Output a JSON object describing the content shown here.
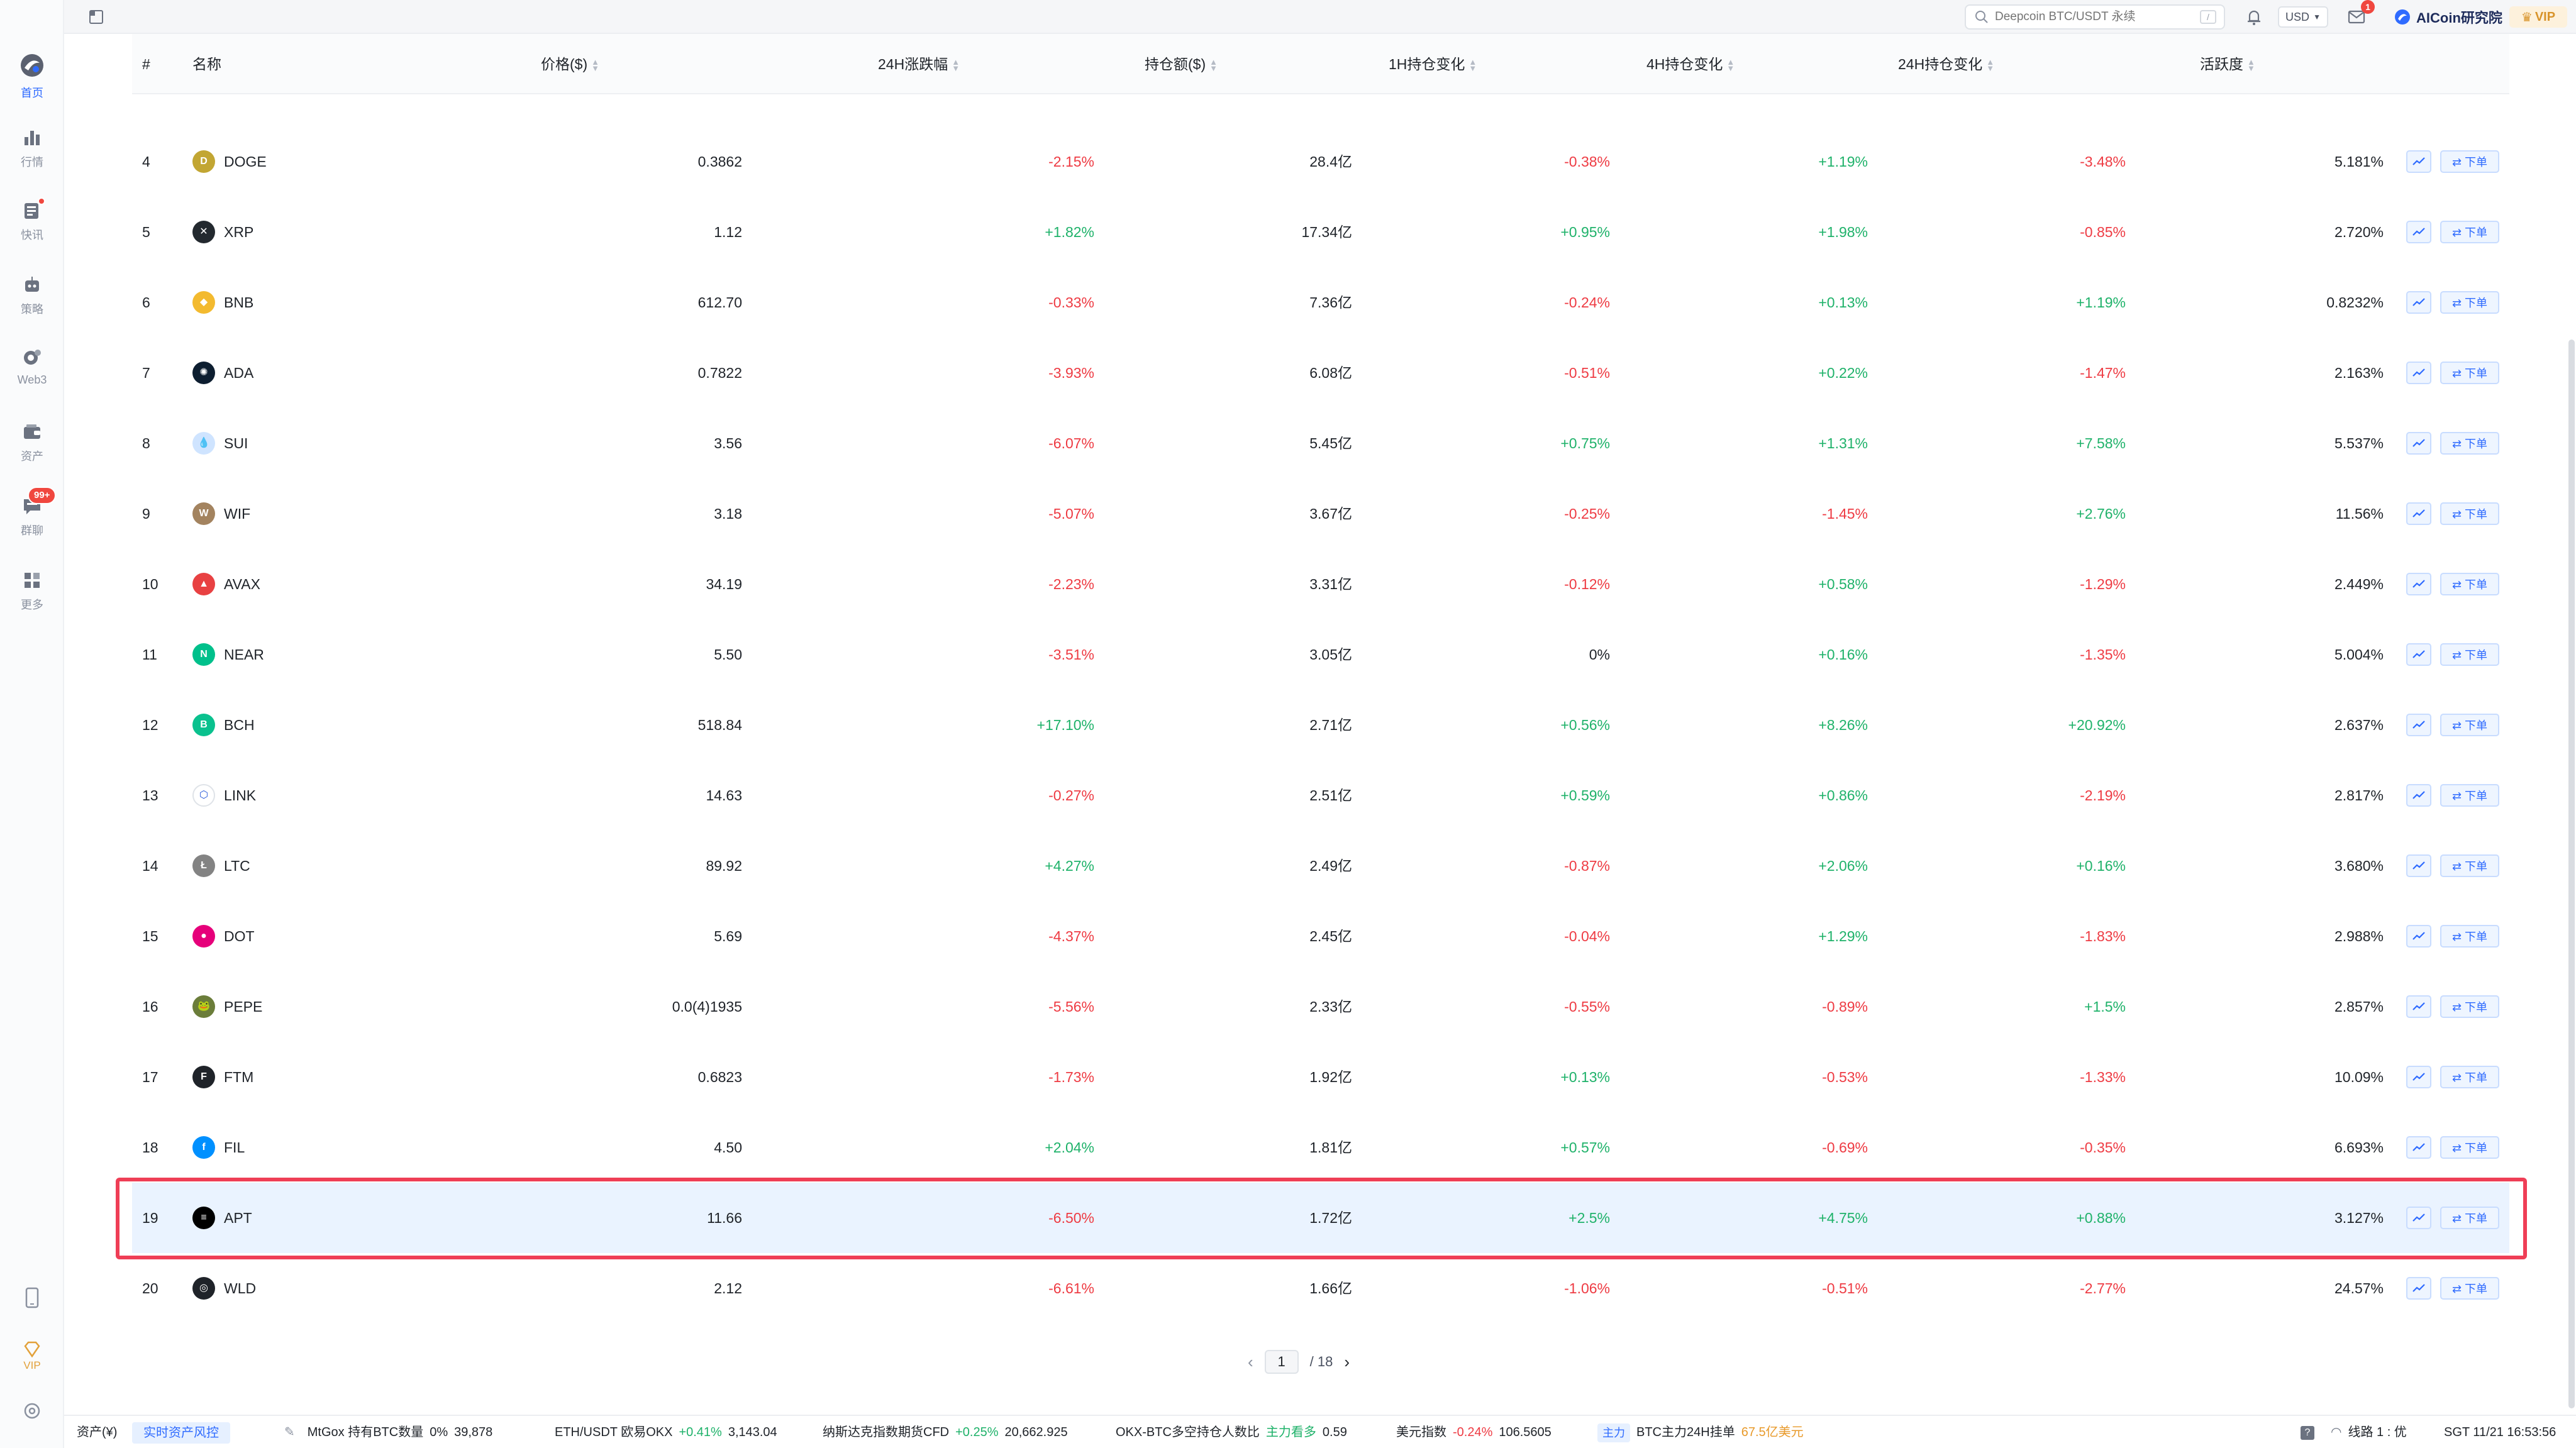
{
  "topbar": {
    "search_placeholder": "Deepcoin BTC/USDT 永续",
    "search_key": "/",
    "currency": "USD",
    "mail_badge": "1",
    "user_name": "AICoin研究院",
    "vip_label": "VIP"
  },
  "sidebar": {
    "items": [
      {
        "label": "首页",
        "icon": "home-icon"
      },
      {
        "label": "行情",
        "icon": "market-chart-icon"
      },
      {
        "label": "快讯",
        "icon": "news-icon"
      },
      {
        "label": "策略",
        "icon": "robot-icon"
      },
      {
        "label": "Web3",
        "icon": "web3-icon"
      },
      {
        "label": "资产",
        "icon": "wallet-icon"
      },
      {
        "label": "群聊",
        "icon": "chat-icon"
      },
      {
        "label": "更多",
        "icon": "grid-more-icon"
      }
    ],
    "chat_badge": "99+",
    "bottom_vip": "VIP"
  },
  "table": {
    "headers": {
      "rank": "#",
      "name": "名称",
      "price": "价格($)",
      "chg24": "24H涨跌幅",
      "hold": "持仓额($)",
      "h1": "1H持仓变化",
      "h4": "4H持仓变化",
      "h24": "24H持仓变化",
      "activity": "活跃度"
    },
    "chart_btn_icon": "trend-chart-icon",
    "order_btn_label": "⇄ 下单",
    "rows": [
      {
        "rank": "4",
        "coin": "DOGE",
        "price": "0.3862",
        "chg24": "-2.15%",
        "hold": "28.4亿",
        "h1": "-0.38%",
        "h4": "+1.19%",
        "h24": "-3.48%",
        "activity": "5.181%",
        "color": "#c2a633",
        "glyph": "D"
      },
      {
        "rank": "5",
        "coin": "XRP",
        "price": "1.12",
        "chg24": "+1.82%",
        "hold": "17.34亿",
        "h1": "+0.95%",
        "h4": "+1.98%",
        "h24": "-0.85%",
        "activity": "2.720%",
        "color": "#23292f",
        "glyph": "✕"
      },
      {
        "rank": "6",
        "coin": "BNB",
        "price": "612.70",
        "chg24": "-0.33%",
        "hold": "7.36亿",
        "h1": "-0.24%",
        "h4": "+0.13%",
        "h24": "+1.19%",
        "activity": "0.8232%",
        "color": "#f3ba2f",
        "glyph": "◆"
      },
      {
        "rank": "7",
        "coin": "ADA",
        "price": "0.7822",
        "chg24": "-3.93%",
        "hold": "6.08亿",
        "h1": "-0.51%",
        "h4": "+0.22%",
        "h24": "-1.47%",
        "activity": "2.163%",
        "color": "#0d1e30",
        "glyph": "✺"
      },
      {
        "rank": "8",
        "coin": "SUI",
        "price": "3.56",
        "chg24": "-6.07%",
        "hold": "5.45亿",
        "h1": "+0.75%",
        "h4": "+1.31%",
        "h24": "+7.58%",
        "activity": "5.537%",
        "color": "#cfe4ff",
        "glyph": "💧"
      },
      {
        "rank": "9",
        "coin": "WIF",
        "price": "3.18",
        "chg24": "-5.07%",
        "hold": "3.67亿",
        "h1": "-0.25%",
        "h4": "-1.45%",
        "h24": "+2.76%",
        "activity": "11.56%",
        "color": "#a3835f",
        "glyph": "W"
      },
      {
        "rank": "10",
        "coin": "AVAX",
        "price": "34.19",
        "chg24": "-2.23%",
        "hold": "3.31亿",
        "h1": "-0.12%",
        "h4": "+0.58%",
        "h24": "-1.29%",
        "activity": "2.449%",
        "color": "#e84142",
        "glyph": "▲"
      },
      {
        "rank": "11",
        "coin": "NEAR",
        "price": "5.50",
        "chg24": "-3.51%",
        "hold": "3.05亿",
        "h1": "0%",
        "h4": "+0.16%",
        "h24": "-1.35%",
        "activity": "5.004%",
        "color": "#00c08b",
        "glyph": "N"
      },
      {
        "rank": "12",
        "coin": "BCH",
        "price": "518.84",
        "chg24": "+17.10%",
        "hold": "2.71亿",
        "h1": "+0.56%",
        "h4": "+8.26%",
        "h24": "+20.92%",
        "activity": "2.637%",
        "color": "#0ac18e",
        "glyph": "B"
      },
      {
        "rank": "13",
        "coin": "LINK",
        "price": "14.63",
        "chg24": "-0.27%",
        "hold": "2.51亿",
        "h1": "+0.59%",
        "h4": "+0.86%",
        "h24": "-2.19%",
        "activity": "2.817%",
        "color": "#ffffff",
        "glyph": "⬡"
      },
      {
        "rank": "14",
        "coin": "LTC",
        "price": "89.92",
        "chg24": "+4.27%",
        "hold": "2.49亿",
        "h1": "-0.87%",
        "h4": "+2.06%",
        "h24": "+0.16%",
        "activity": "3.680%",
        "color": "#838383",
        "glyph": "Ł"
      },
      {
        "rank": "15",
        "coin": "DOT",
        "price": "5.69",
        "chg24": "-4.37%",
        "hold": "2.45亿",
        "h1": "-0.04%",
        "h4": "+1.29%",
        "h24": "-1.83%",
        "activity": "2.988%",
        "color": "#e6007a",
        "glyph": "●"
      },
      {
        "rank": "16",
        "coin": "PEPE",
        "price": "0.0(4)1935",
        "chg24": "-5.56%",
        "hold": "2.33亿",
        "h1": "-0.55%",
        "h4": "-0.89%",
        "h24": "+1.5%",
        "activity": "2.857%",
        "color": "#6b7d3a",
        "glyph": "🐸"
      },
      {
        "rank": "17",
        "coin": "FTM",
        "price": "0.6823",
        "chg24": "-1.73%",
        "hold": "1.92亿",
        "h1": "+0.13%",
        "h4": "-0.53%",
        "h24": "-1.33%",
        "activity": "10.09%",
        "color": "#1f2329",
        "glyph": "F"
      },
      {
        "rank": "18",
        "coin": "FIL",
        "price": "4.50",
        "chg24": "+2.04%",
        "hold": "1.81亿",
        "h1": "+0.57%",
        "h4": "-0.69%",
        "h24": "-0.35%",
        "activity": "6.693%",
        "color": "#0090ff",
        "glyph": "f"
      },
      {
        "rank": "19",
        "coin": "APT",
        "price": "11.66",
        "chg24": "-6.50%",
        "hold": "1.72亿",
        "h1": "+2.5%",
        "h4": "+4.75%",
        "h24": "+0.88%",
        "activity": "3.127%",
        "color": "#000000",
        "glyph": "≡"
      },
      {
        "rank": "20",
        "coin": "WLD",
        "price": "2.12",
        "chg24": "-6.61%",
        "hold": "1.66亿",
        "h1": "-1.06%",
        "h4": "-0.51%",
        "h24": "-2.77%",
        "activity": "24.57%",
        "color": "#1f2329",
        "glyph": "◎"
      }
    ]
  },
  "pagination": {
    "current": "1",
    "total": "/ 18"
  },
  "footer": {
    "assets_label": "资产(¥)",
    "risk_tag": "实时资产风控",
    "mtgox": {
      "label": "MtGox 持有BTC数量",
      "pct": "0%",
      "value": "39,878"
    },
    "ethusdt": {
      "label": "ETH/USDT 欧易OKX",
      "pct": "+0.41%",
      "value": "3,143.04"
    },
    "nasdaq": {
      "label": "纳斯达克指数期货CFD",
      "pct": "+0.25%",
      "value": "20,662.925"
    },
    "okx_ratio": {
      "label": "OKX-BTC多空持仓人数比",
      "tag": "主力看多",
      "value": "0.59"
    },
    "usd_index": {
      "label": "美元指数",
      "pct": "-0.24%",
      "value": "106.5605"
    },
    "btc_main": {
      "tag": "主力",
      "label": "BTC主力24H挂单",
      "value": "67.5亿美元"
    },
    "line_label": "线路 1 : 优",
    "timestamp": "SGT 11/21 16:53:56"
  }
}
